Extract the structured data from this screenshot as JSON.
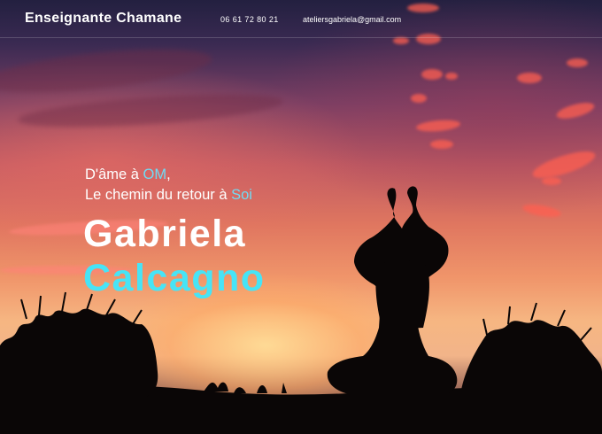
{
  "header": {
    "brand": "Enseignante Chamane",
    "phone": "06 61 72 80 21",
    "email": "ateliersgabriela@gmail.com"
  },
  "hero": {
    "tagline_line1_prefix": "D'âme à ",
    "tagline_line1_accent": "OM",
    "tagline_line1_suffix": ",",
    "tagline_line2_prefix": "Le chemin du retour à ",
    "tagline_line2_accent": "Soi",
    "first_name": "Gabriela",
    "last_name": "Calcagno"
  },
  "colors": {
    "accent": "#47e4f6",
    "text": "#ffffff"
  },
  "background": {
    "image": "yoga-sunset-silhouette"
  }
}
